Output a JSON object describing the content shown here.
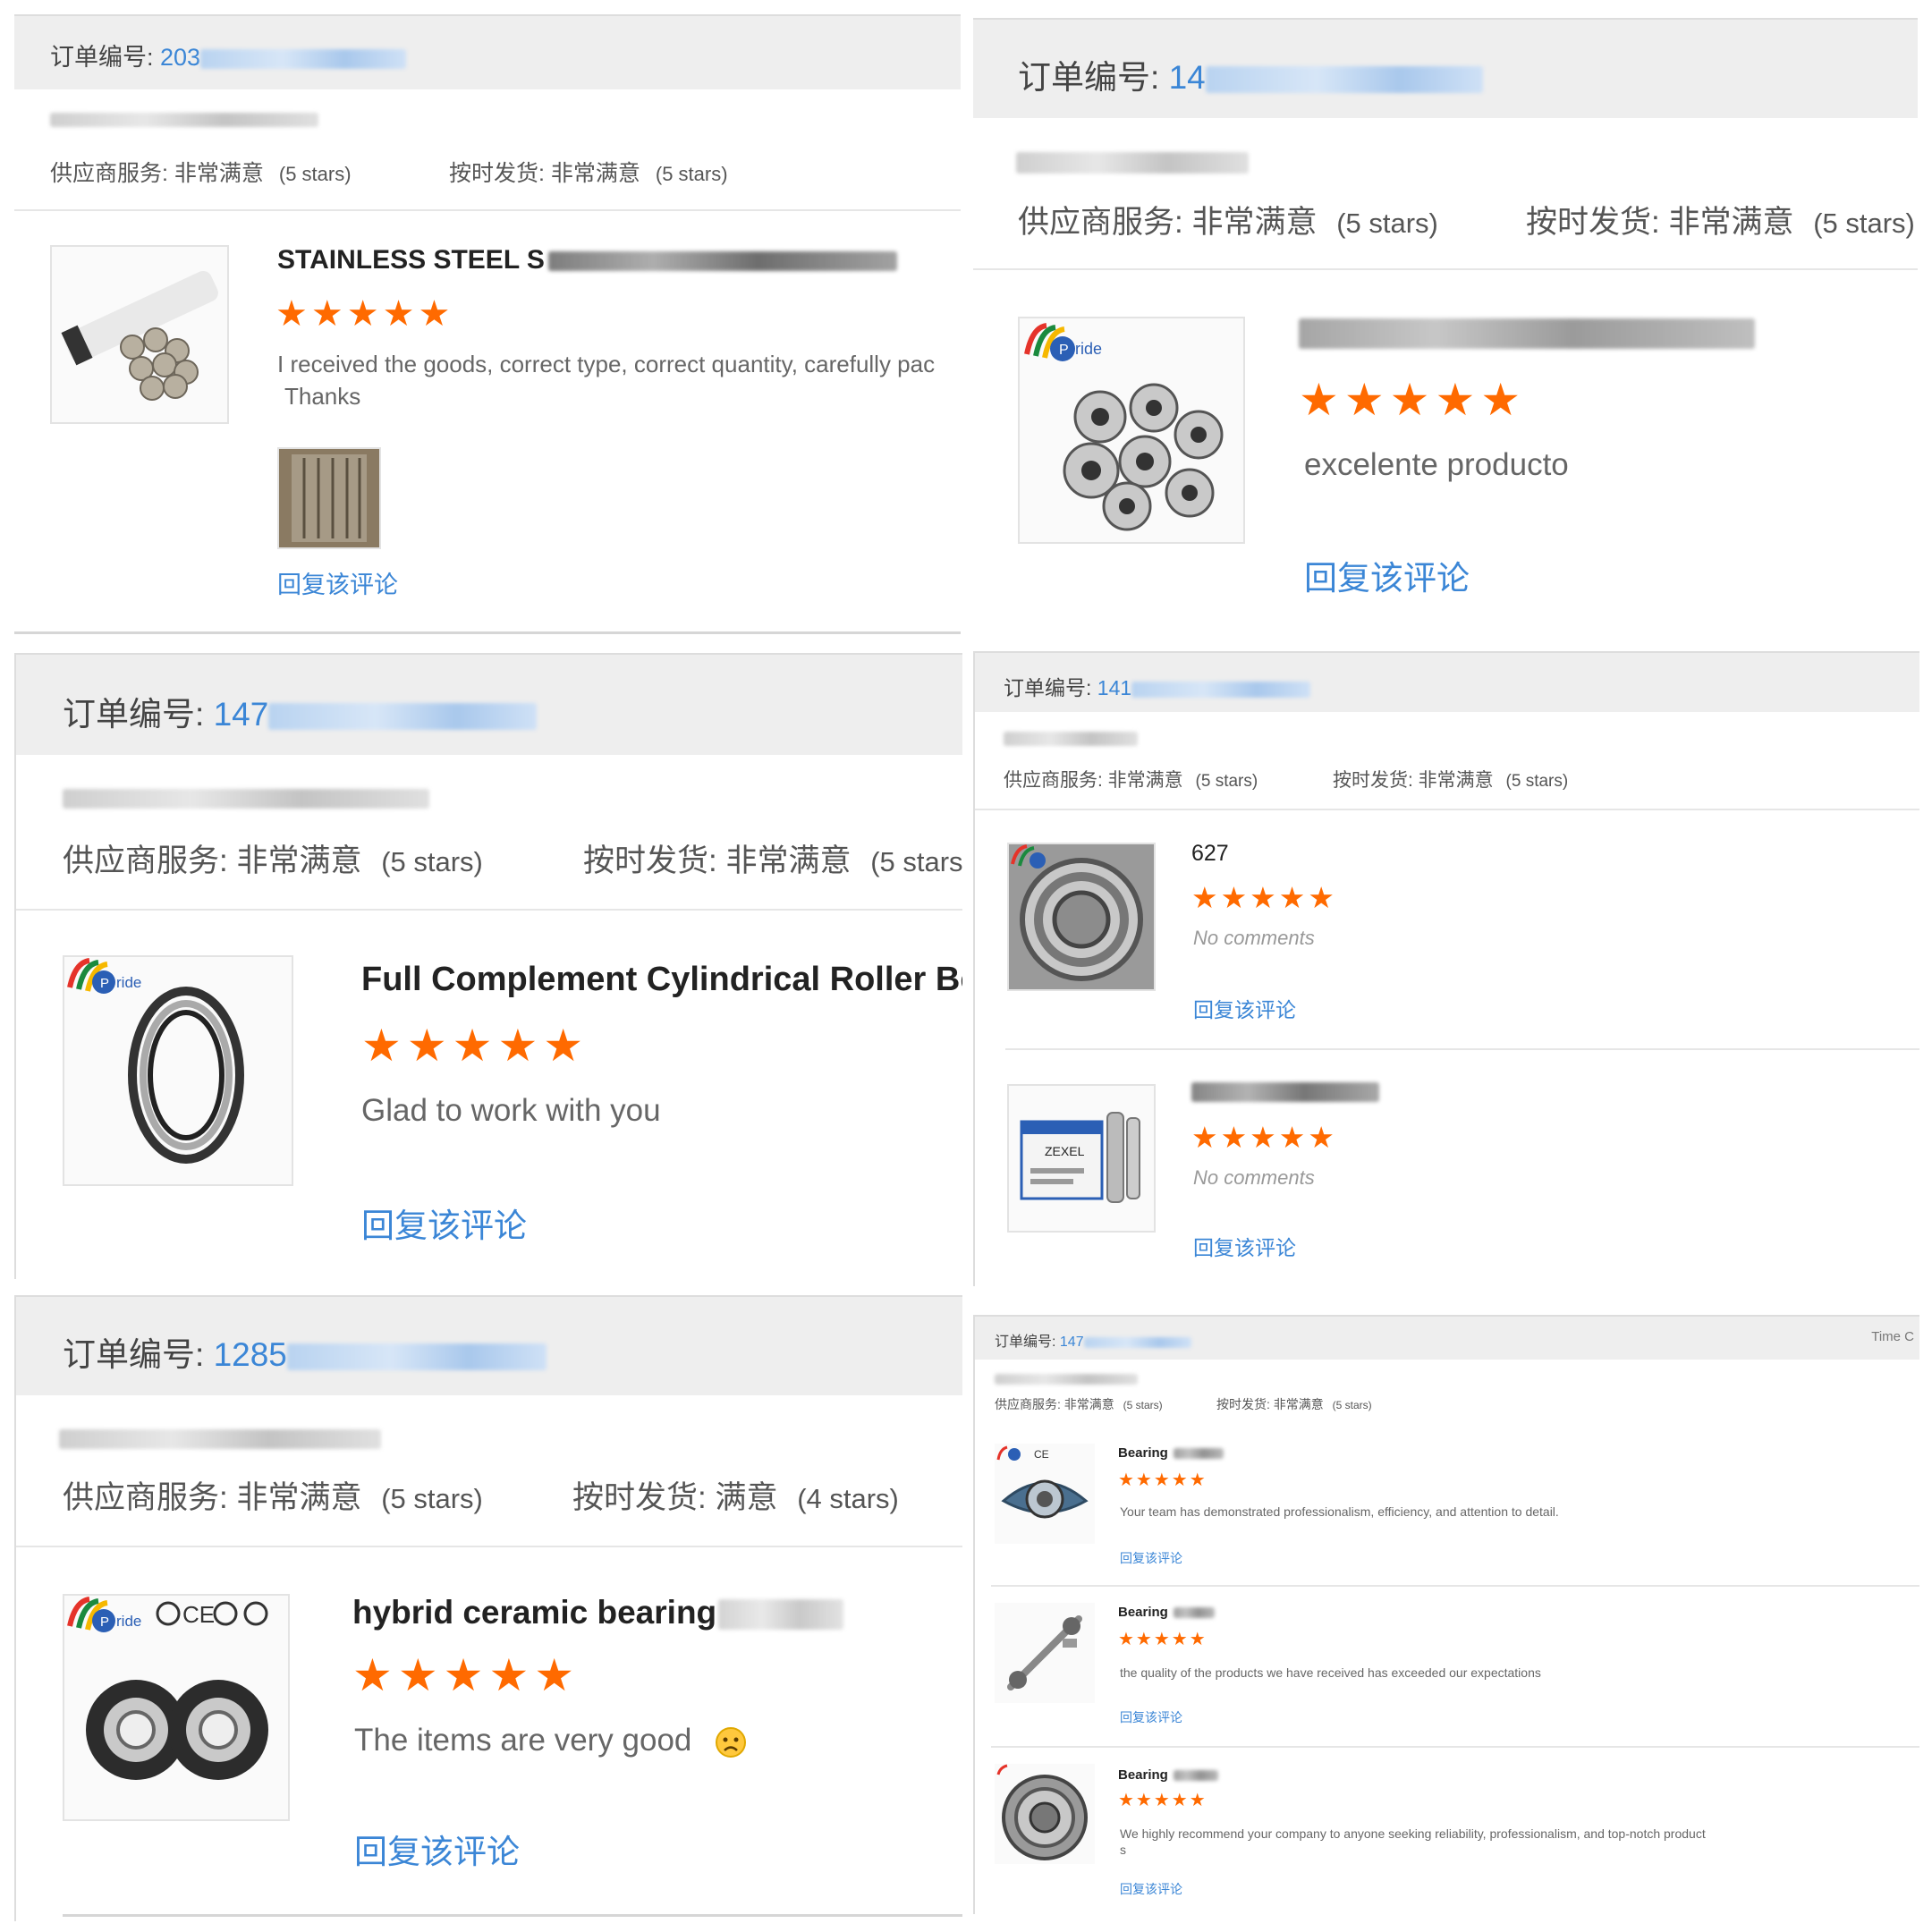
{
  "labels": {
    "order_prefix": "订单编号: ",
    "supplier_service": "供应商服务: ",
    "on_time_delivery": "按时发货: ",
    "reply": "回复该评论",
    "stars_5": "(5 stars)",
    "stars_4": "(4 stars)",
    "very_satisfied": "非常满意",
    "satisfied": "满意",
    "no_comments": "No comments",
    "time_label": "Time C",
    "star_glyphs": "★★★★★"
  },
  "panels": {
    "p1": {
      "order_no": "203",
      "title": "STAINLESS STEEL S",
      "comment": "I received the goods, correct type, correct quantity, carefully pac",
      "comment2": "Thanks"
    },
    "p2": {
      "order_no": "14",
      "comment": "excelente producto"
    },
    "p3": {
      "order_no": "147",
      "title": "Full Complement Cylindrical Roller Be",
      "comment": "Glad to work with you"
    },
    "p4": {
      "order_no": "141",
      "item1_title": "627"
    },
    "p5": {
      "order_no": "1285",
      "title": "hybrid ceramic bearing",
      "comment": "The items are very good"
    },
    "p6": {
      "order_no": "147",
      "item_title": "Bearing",
      "item1_comment": "Your team has demonstrated professionalism, efficiency, and attention to detail.",
      "item2_comment": "the quality of the products we have received has exceeded our expectations",
      "item3_comment": "We highly recommend your company to anyone seeking reliability, professionalism, and top-notch product",
      "item3_comment2": "s"
    }
  },
  "colors": {
    "accent_blue": "#3b86d6",
    "star_orange": "#ff6a00",
    "header_grey": "#eeeeee"
  },
  "icons": {
    "star": "star-icon",
    "pride_logo": "pride-logo",
    "cert_marks": "ce-certification-marks",
    "emoji": "sad-face-emoji"
  }
}
